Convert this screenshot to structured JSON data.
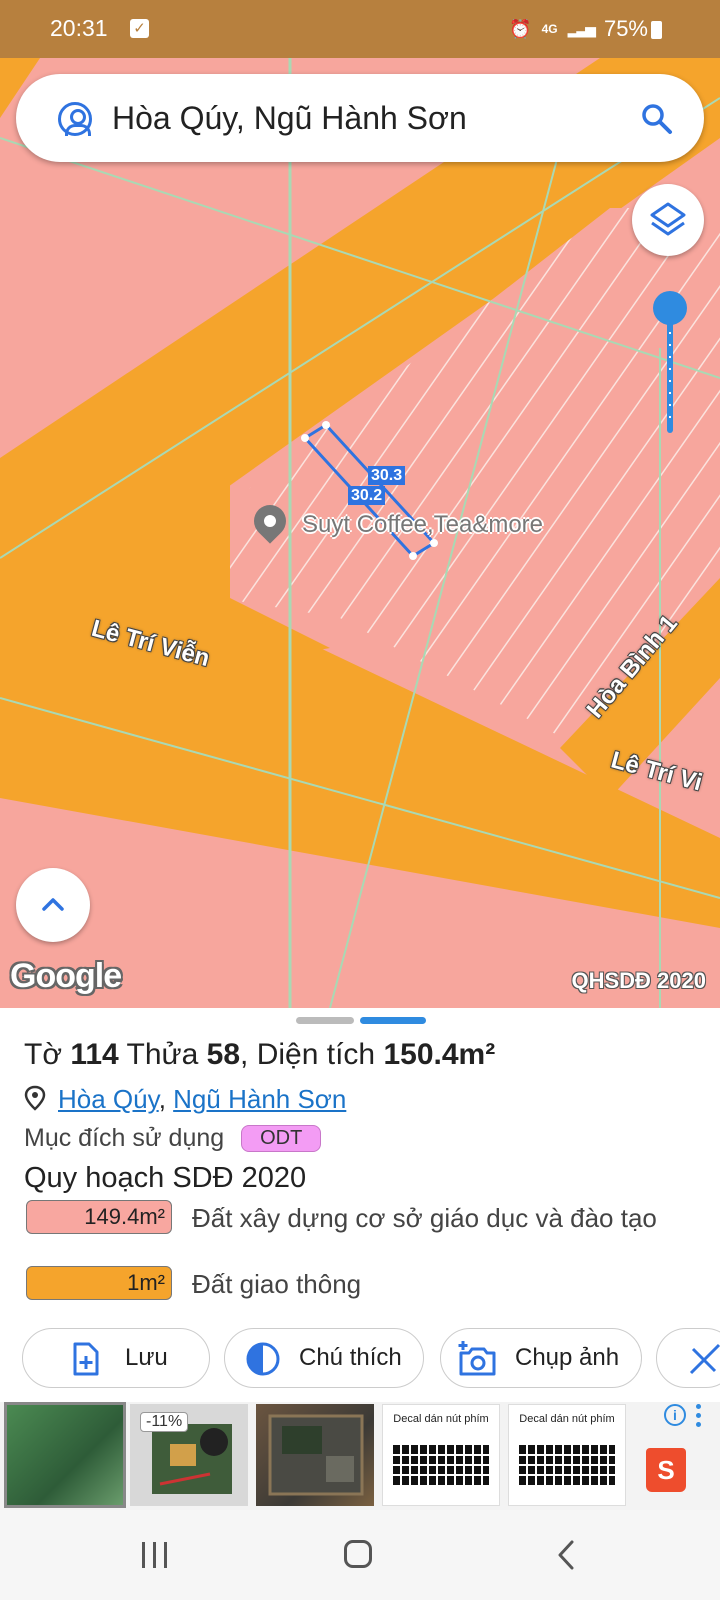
{
  "status_bar": {
    "time": "20:31",
    "network": "4G",
    "battery": "75%"
  },
  "search": {
    "query": "Hòa Qúy, Ngũ Hành Sơn"
  },
  "map": {
    "poi_name": "Suyt Coffee,Tea&more",
    "measure_a": "30.3",
    "measure_b": "30.2",
    "streets": [
      "Lê Trí Viễn",
      "Hòa Bình 1",
      "Lê Trí Vi"
    ],
    "google_logo": "Google",
    "layer_label": "QHSDĐ 2020",
    "colors": {
      "land": "#f7a69d",
      "road": "#f5a42c",
      "grid": "#a9d9b4",
      "measure": "#2f73e0"
    }
  },
  "sheet": {
    "parcel": {
      "sheet_label": "Tờ",
      "sheet_no": "114",
      "plot_label": "Thửa",
      "plot_no": "58",
      "area_label": ", Diện tích",
      "area_value": "150.4m²"
    },
    "location": {
      "ward": "Hòa Qúy",
      "separator": ",",
      "district": "Ngũ Hành Sơn"
    },
    "purpose": {
      "label": "Mục đích sử dụng",
      "code": "ODT"
    },
    "plan": {
      "title": "Quy hoạch SDĐ 2020",
      "rows": [
        {
          "area": "149.4m²",
          "desc": "Đất xây dựng cơ sở giáo dục và đào tạo",
          "color": "#f8a7a0"
        },
        {
          "area": "1m²",
          "desc": "Đất giao thông",
          "color": "#f5a42c"
        }
      ]
    },
    "actions": [
      {
        "label": "Lưu",
        "icon": "add-document-icon"
      },
      {
        "label": "Chú thích",
        "icon": "contrast-icon"
      },
      {
        "label": "Chụp ảnh",
        "icon": "add-photo-icon"
      },
      {
        "label": "",
        "icon": "ruler-icon"
      }
    ]
  },
  "ads": {
    "discount": "-11%",
    "decal_title": "Decal dán nút phím",
    "shopee_letter": "S",
    "info_icon": "i"
  }
}
